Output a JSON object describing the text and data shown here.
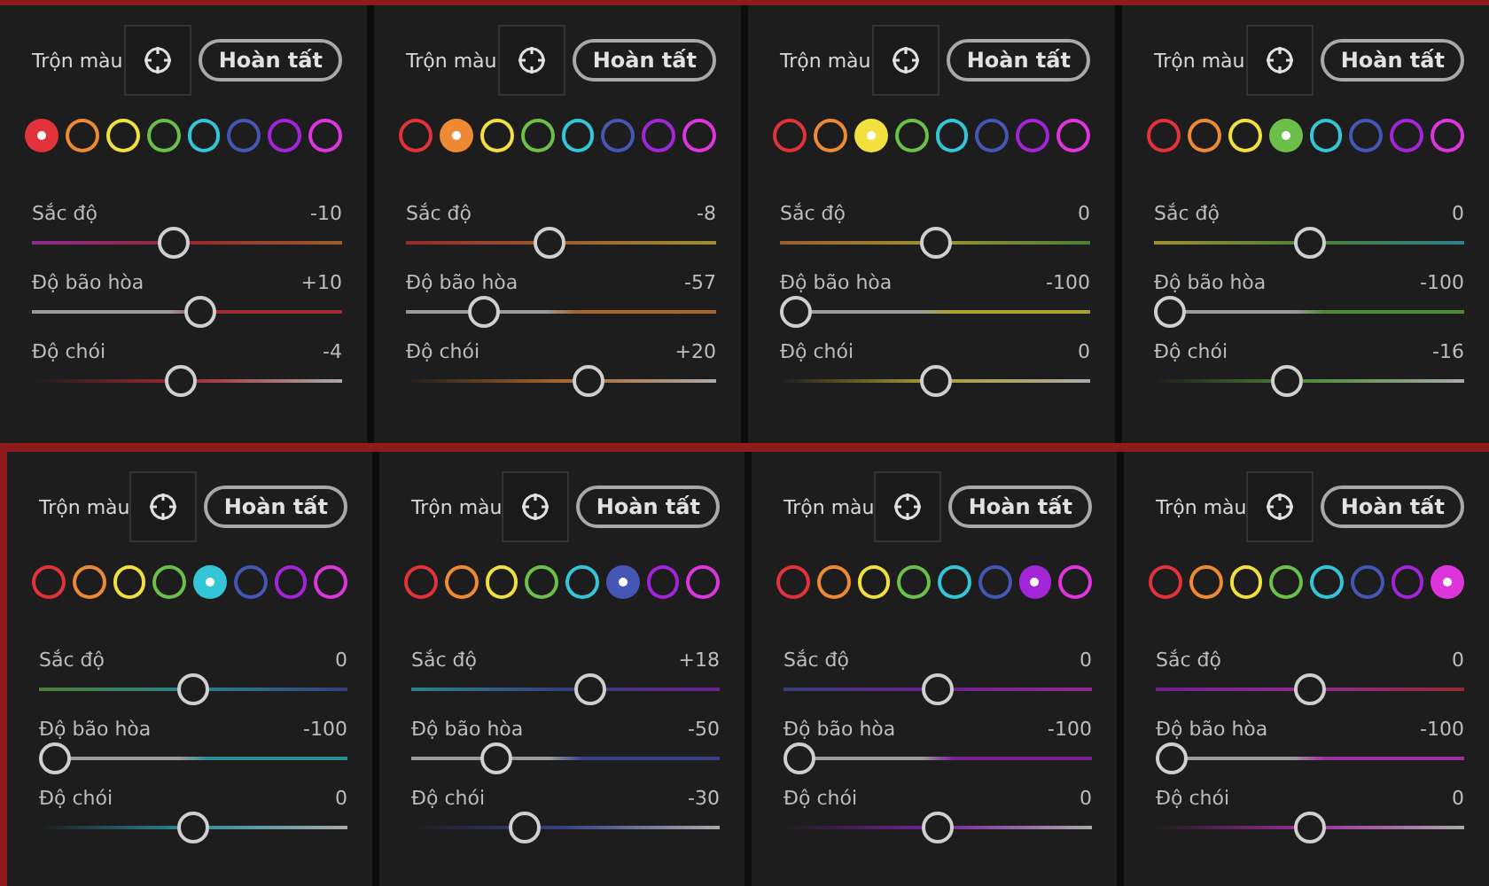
{
  "panels": [
    {
      "title": "Trộn màu",
      "done_button": "Hoàn tất",
      "swatches": [
        {
          "color": "#e2323c",
          "selected": true
        },
        {
          "color": "#ee8a34",
          "selected": false
        },
        {
          "color": "#f2e040",
          "selected": false
        },
        {
          "color": "#6cbf48",
          "selected": false
        },
        {
          "color": "#34c6d6",
          "selected": false
        },
        {
          "color": "#4656b4",
          "selected": false
        },
        {
          "color": "#a226d8",
          "selected": false
        },
        {
          "color": "#dc36dc",
          "selected": false
        }
      ],
      "sliders": [
        {
          "label": "Sắc độ",
          "value": "-10",
          "level": 0.45
        },
        {
          "label": "Độ bão hòa",
          "value": "+10",
          "level": 0.55
        },
        {
          "label": "Độ chói",
          "value": "-4",
          "level": 0.48
        }
      ]
    },
    {
      "title": "Trộn màu",
      "done_button": "Hoàn tất",
      "swatches": [
        {
          "color": "#e2323c",
          "selected": false
        },
        {
          "color": "#ee8a34",
          "selected": true
        },
        {
          "color": "#f2e040",
          "selected": false
        },
        {
          "color": "#6cbf48",
          "selected": false
        },
        {
          "color": "#34c6d6",
          "selected": false
        },
        {
          "color": "#4656b4",
          "selected": false
        },
        {
          "color": "#a226d8",
          "selected": false
        },
        {
          "color": "#dc36dc",
          "selected": false
        }
      ],
      "sliders": [
        {
          "label": "Sắc độ",
          "value": "-8",
          "level": 0.46
        },
        {
          "label": "Độ bão hòa",
          "value": "-57",
          "level": 0.22
        },
        {
          "label": "Độ chói",
          "value": "+20",
          "level": 0.6
        }
      ]
    },
    {
      "title": "Trộn màu",
      "done_button": "Hoàn tất",
      "swatches": [
        {
          "color": "#e2323c",
          "selected": false
        },
        {
          "color": "#ee8a34",
          "selected": false
        },
        {
          "color": "#f2e040",
          "selected": true
        },
        {
          "color": "#6cbf48",
          "selected": false
        },
        {
          "color": "#34c6d6",
          "selected": false
        },
        {
          "color": "#4656b4",
          "selected": false
        },
        {
          "color": "#a226d8",
          "selected": false
        },
        {
          "color": "#dc36dc",
          "selected": false
        }
      ],
      "sliders": [
        {
          "label": "Sắc độ",
          "value": "0",
          "level": 0.5
        },
        {
          "label": "Độ bão hòa",
          "value": "-100",
          "level": 0
        },
        {
          "label": "Độ chói",
          "value": "0",
          "level": 0.5
        }
      ]
    },
    {
      "title": "Trộn màu",
      "done_button": "Hoàn tất",
      "swatches": [
        {
          "color": "#e2323c",
          "selected": false
        },
        {
          "color": "#ee8a34",
          "selected": false
        },
        {
          "color": "#f2e040",
          "selected": false
        },
        {
          "color": "#6cbf48",
          "selected": true
        },
        {
          "color": "#34c6d6",
          "selected": false
        },
        {
          "color": "#4656b4",
          "selected": false
        },
        {
          "color": "#a226d8",
          "selected": false
        },
        {
          "color": "#dc36dc",
          "selected": false
        }
      ],
      "sliders": [
        {
          "label": "Sắc độ",
          "value": "0",
          "level": 0.5
        },
        {
          "label": "Độ bão hòa",
          "value": "-100",
          "level": 0
        },
        {
          "label": "Độ chói",
          "value": "-16",
          "level": 0.42
        }
      ]
    },
    {
      "title": "Trộn màu",
      "done_button": "Hoàn tất",
      "swatches": [
        {
          "color": "#e2323c",
          "selected": false
        },
        {
          "color": "#ee8a34",
          "selected": false
        },
        {
          "color": "#f2e040",
          "selected": false
        },
        {
          "color": "#6cbf48",
          "selected": false
        },
        {
          "color": "#34c6d6",
          "selected": true
        },
        {
          "color": "#4656b4",
          "selected": false
        },
        {
          "color": "#a226d8",
          "selected": false
        },
        {
          "color": "#dc36dc",
          "selected": false
        }
      ],
      "sliders": [
        {
          "label": "Sắc độ",
          "value": "0",
          "level": 0.5
        },
        {
          "label": "Độ bão hòa",
          "value": "-100",
          "level": 0
        },
        {
          "label": "Độ chói",
          "value": "0",
          "level": 0.5
        }
      ]
    },
    {
      "title": "Trộn màu",
      "done_button": "Hoàn tất",
      "swatches": [
        {
          "color": "#e2323c",
          "selected": false
        },
        {
          "color": "#ee8a34",
          "selected": false
        },
        {
          "color": "#f2e040",
          "selected": false
        },
        {
          "color": "#6cbf48",
          "selected": false
        },
        {
          "color": "#34c6d6",
          "selected": false
        },
        {
          "color": "#4656b4",
          "selected": true
        },
        {
          "color": "#a226d8",
          "selected": false
        },
        {
          "color": "#dc36dc",
          "selected": false
        }
      ],
      "sliders": [
        {
          "label": "Sắc độ",
          "value": "+18",
          "level": 0.59
        },
        {
          "label": "Độ bão hòa",
          "value": "-50",
          "level": 0.25
        },
        {
          "label": "Độ chói",
          "value": "-30",
          "level": 0.35
        }
      ]
    },
    {
      "title": "Trộn màu",
      "done_button": "Hoàn tất",
      "swatches": [
        {
          "color": "#e2323c",
          "selected": false
        },
        {
          "color": "#ee8a34",
          "selected": false
        },
        {
          "color": "#f2e040",
          "selected": false
        },
        {
          "color": "#6cbf48",
          "selected": false
        },
        {
          "color": "#34c6d6",
          "selected": false
        },
        {
          "color": "#4656b4",
          "selected": false
        },
        {
          "color": "#a226d8",
          "selected": true
        },
        {
          "color": "#dc36dc",
          "selected": false
        }
      ],
      "sliders": [
        {
          "label": "Sắc độ",
          "value": "0",
          "level": 0.5
        },
        {
          "label": "Độ bão hòa",
          "value": "-100",
          "level": 0
        },
        {
          "label": "Độ chói",
          "value": "0",
          "level": 0.5
        }
      ]
    },
    {
      "title": "Trộn màu",
      "done_button": "Hoàn tất",
      "swatches": [
        {
          "color": "#e2323c",
          "selected": false
        },
        {
          "color": "#ee8a34",
          "selected": false
        },
        {
          "color": "#f2e040",
          "selected": false
        },
        {
          "color": "#6cbf48",
          "selected": false
        },
        {
          "color": "#34c6d6",
          "selected": false
        },
        {
          "color": "#4656b4",
          "selected": false
        },
        {
          "color": "#a226d8",
          "selected": false
        },
        {
          "color": "#dc36dc",
          "selected": true
        }
      ],
      "sliders": [
        {
          "label": "Sắc độ",
          "value": "0",
          "level": 0.5
        },
        {
          "label": "Độ bão hòa",
          "value": "-100",
          "level": 0
        },
        {
          "label": "Độ chói",
          "value": "0",
          "level": 0.5
        }
      ]
    }
  ]
}
